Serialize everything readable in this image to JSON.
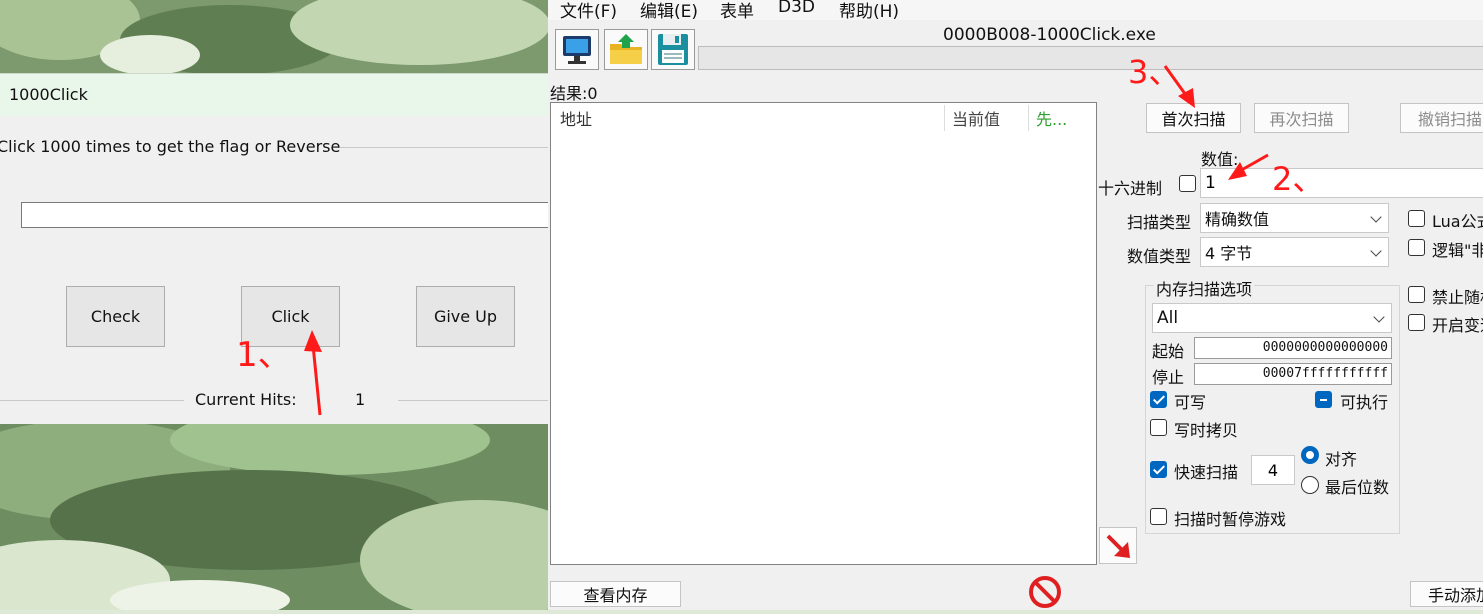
{
  "click_app": {
    "title": "1000Click",
    "group_label": "Click 1000 times to get the flag or Reverse",
    "input_value": "",
    "buttons": {
      "check": "Check",
      "click": "Click",
      "give_up": "Give Up"
    },
    "hits_label": "Current Hits:",
    "hits_value": "1"
  },
  "cheat_engine": {
    "menu": [
      "文件(F)",
      "编辑(E)",
      "表单",
      "D3D",
      "帮助(H)"
    ],
    "toolbar_icons": [
      "computer-icon",
      "open-folder-icon",
      "save-disk-icon"
    ],
    "process_title": "0000B008-1000Click.exe",
    "results_label": "结果:0",
    "columns": {
      "address": "地址",
      "current_value": "当前值",
      "previous": "先..."
    },
    "buttons": {
      "first_scan": "首次扫描",
      "next_scan": "再次扫描",
      "undo_scan": "撤销扫描",
      "view_memory": "查看内存",
      "add_manual": "手动添加"
    },
    "value_label": "数值:",
    "hex_label": "十六进制",
    "value_input": "1",
    "scan_type_label": "扫描类型",
    "scan_type_value": "精确数值",
    "value_type_label": "数值类型",
    "value_type_value": "4 字节",
    "lua_label": "Lua公式",
    "logic_label": "逻辑\"非\"",
    "memory_options_label": "内存扫描选项",
    "region_value": "All",
    "start_label": "起始",
    "start_value": "0000000000000000",
    "stop_label": "停止",
    "stop_value": "00007fffffffffff",
    "writable_label": "可写",
    "executable_label": "可执行",
    "copy_on_write_label": "写时拷贝",
    "fast_scan_label": "快速扫描",
    "fast_scan_value": "4",
    "align_label": "对齐",
    "last_digits_label": "最后位数",
    "pause_label": "扫描时暂停游戏",
    "disable_random_label": "禁止随机",
    "enable_speedhack_label": "开启变速"
  },
  "annotations": [
    "1、",
    "2、",
    "3、"
  ],
  "colors": {
    "check_blue": "#0067c0",
    "annotation_red": "#ff1a1a",
    "previous_col_green": "#2e9e2e",
    "title_bar_green": "#e9f6ea"
  }
}
